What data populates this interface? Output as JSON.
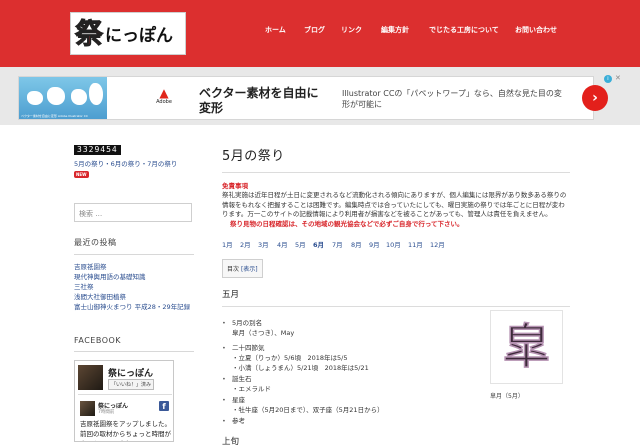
{
  "header": {
    "logo_kanji": "祭",
    "logo_kana": "にっぽん",
    "nav": [
      "ホーム",
      "ブログ",
      "リンク",
      "編集方針",
      "でじたる工房について",
      "お問い合わせ"
    ]
  },
  "ad": {
    "image_caption": "ベクター素材を自由に変形 Adobe Illustrator CC",
    "logo_text": "Adobe",
    "headline": "ベクター素材を自由に変形",
    "body": "Illustrator CCの「パペットワープ」なら、自然な見た目の変形が可能に",
    "cta_icon": "chevron-right-icon",
    "cta_symbol": "›",
    "choices_symbol": "i",
    "close_symbol": "✕"
  },
  "sidebar": {
    "counter": "3329454",
    "counter_caption": "5月の祭り・6月の祭り・7月の祭り",
    "new_badge": "NEW",
    "search_placeholder": "検索 …",
    "recent_title": "最近の投稿",
    "recent_posts": [
      "吉原祇園祭",
      "現代神輿用語の基礎知識",
      "三社祭",
      "浅間大社御田植祭",
      "富士山御神火まつり 平成28・29年記録"
    ],
    "facebook_title": "FACEBOOK",
    "fb_page_name": "祭にっぽん",
    "fb_like_label": "「いいね！」済み",
    "fb_post_author": "祭にっぽん",
    "fb_post_time": "7時間前",
    "fb_post_text": "吉原祇園祭をアップしました。前回の取材からちょっと時間が空いたので、今年は"
  },
  "main": {
    "title": "5月の祭り",
    "notice_title": "免責事項",
    "notice_body": "祭礼実施は近年日程が土日に変更されるなど流動化される傾向にありますが、個人編集には限界があり数多ある祭りの情報をもれなく把握することは困難です。編集時点では合っていたにしても、曜日実施の祭りでは年ごとに日程が変わります。万一このサイトの記載情報により利用者が損害などを被ることがあっても、管理人は責任を負えません。",
    "notice_warn": "祭り見物の日程確認は、その地域の観光協会などで必ずご自身で行って下さい。",
    "months": [
      "1月",
      "2月",
      "3月",
      "4月",
      "5月",
      "6月",
      "7月",
      "8月",
      "9月",
      "10月",
      "11月",
      "12月"
    ],
    "active_month": "6月",
    "toc_label": "目次",
    "toc_toggle": "[表示]",
    "section_title": "五月",
    "info": {
      "alias_label": "5月の別名",
      "alias_value": "皐月（さつき）、May",
      "solar_label": "二十四節気",
      "solar_1": "・立夏（りっか）5/6頃　2018年は5/5",
      "solar_2": "・小満（しょうまん）5/21頃　2018年は5/21",
      "birthstone_label": "誕生石",
      "birthstone_value": "・エメラルド",
      "zodiac_label": "星座",
      "zodiac_value": "・牡牛座（5月20日まで）、双子座（5月21日から）",
      "reference_label": "参考",
      "image_char": "皐",
      "image_caption": "皐月（5月）"
    },
    "next_heading": "上旬"
  }
}
